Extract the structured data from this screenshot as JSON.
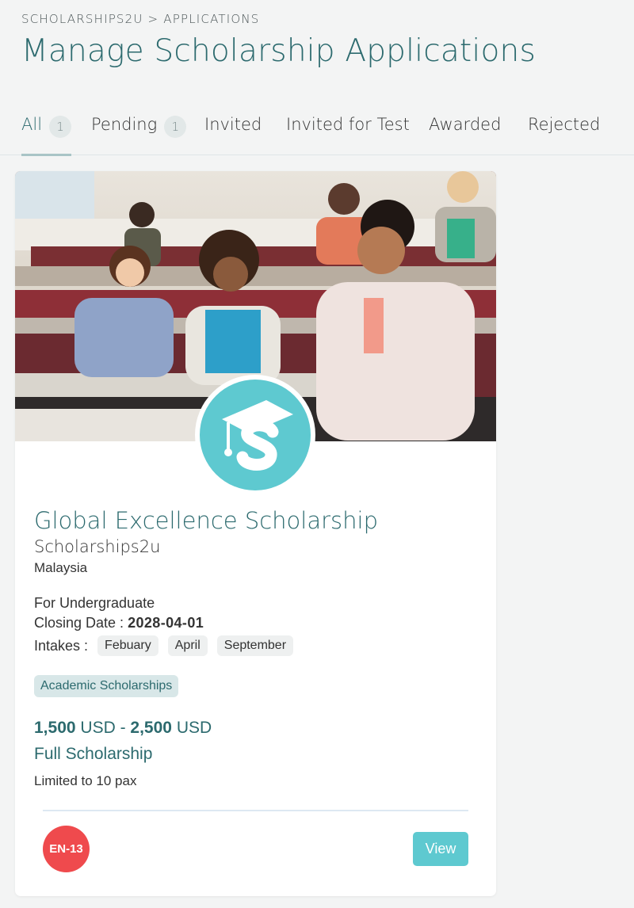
{
  "breadcrumb": "SCHOLARSHIPS2U > APPLICATIONS",
  "page_title": "Manage Scholarship Applications",
  "tabs": [
    {
      "label": "All",
      "count": "1"
    },
    {
      "label": "Pending",
      "count": "1"
    },
    {
      "label": "Invited"
    },
    {
      "label": "Invited for Test"
    },
    {
      "label": "Awarded"
    },
    {
      "label": "Rejected"
    }
  ],
  "card": {
    "logo_icon": "scholarships2u-graduation-cap-logo",
    "title": "Global Excellence Scholarship",
    "provider": "Scholarships2u",
    "country": "Malaysia",
    "level": "For Undergraduate",
    "closing_label": "Closing Date : ",
    "closing_date": "2028-04-01",
    "intakes_label": "Intakes : ",
    "intakes": [
      "Febuary",
      "April",
      "September"
    ],
    "category": "Academic Scholarships",
    "amount_min": "1,500",
    "amount_max": "2,500",
    "currency": "USD",
    "amount_separator": " - ",
    "fund_type": "Full Scholarship",
    "limit": "Limited to 10 pax",
    "code": "EN-13",
    "view_label": "View"
  },
  "colors": {
    "accent": "#2c6a6e",
    "brand_teal": "#5ec9d0",
    "badge_red": "#ef4a4d",
    "background": "#f3f4f4"
  }
}
